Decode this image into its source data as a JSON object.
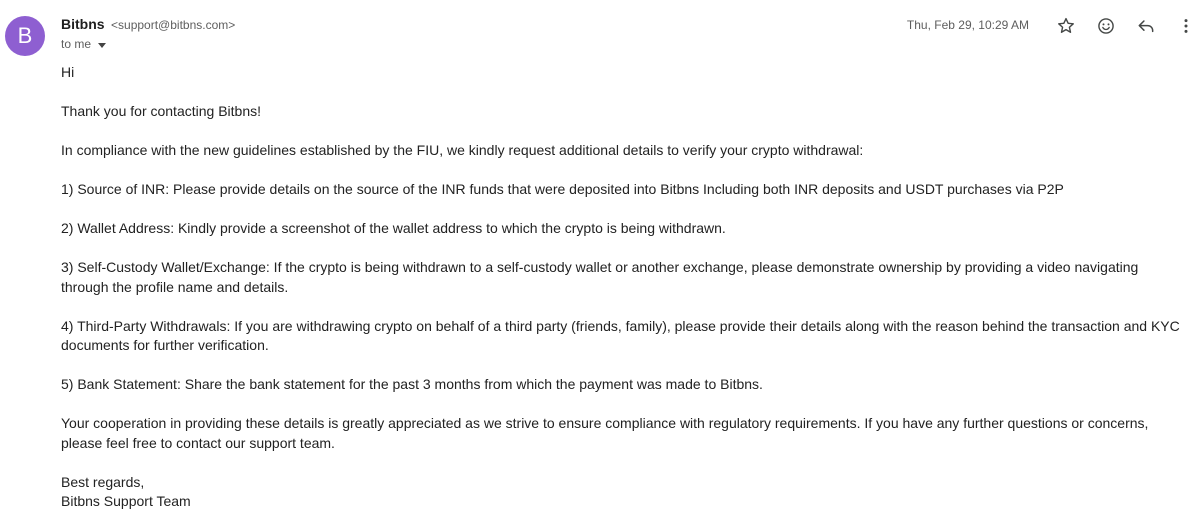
{
  "sender": {
    "avatar_letter": "B",
    "avatar_color": "#8e5fd1",
    "name": "Bitbns",
    "email": "<support@bitbns.com>",
    "recipient": "to me"
  },
  "timestamp": "Thu, Feb 29, 10:29 AM",
  "toolbar": {
    "icons": [
      "star-icon",
      "emoji-icon",
      "reply-icon",
      "more-vert-icon"
    ]
  },
  "message": {
    "greeting": "Hi",
    "thanks": "Thank you for contacting Bitbns!",
    "intro": "In compliance with the new guidelines established by the FIU, we kindly request additional details to verify your crypto withdrawal:",
    "items": [
      "1) Source of INR: Please provide details on the source of the INR funds that were deposited into Bitbns Including both INR deposits and USDT purchases via P2P",
      "2) Wallet Address: Kindly provide a screenshot of the wallet address to which the crypto is being withdrawn.",
      "3) Self-Custody Wallet/Exchange: If the crypto is being withdrawn to a self-custody wallet or another exchange, please demonstrate ownership by providing a video navigating through the profile name and details.",
      "4) Third-Party Withdrawals: If you are withdrawing crypto on behalf of a third party (friends, family), please provide their details along with the reason behind the transaction and KYC documents for further verification.",
      "5) Bank Statement: Share the bank statement for the past 3 months from which the payment was made to Bitbns."
    ],
    "closing": "Your cooperation in providing these details is greatly appreciated as we strive to ensure compliance with regulatory requirements. If you have any further questions or concerns, please feel free to contact our support team.",
    "signoff": "Best regards,",
    "signature": "Bitbns Support Team"
  }
}
